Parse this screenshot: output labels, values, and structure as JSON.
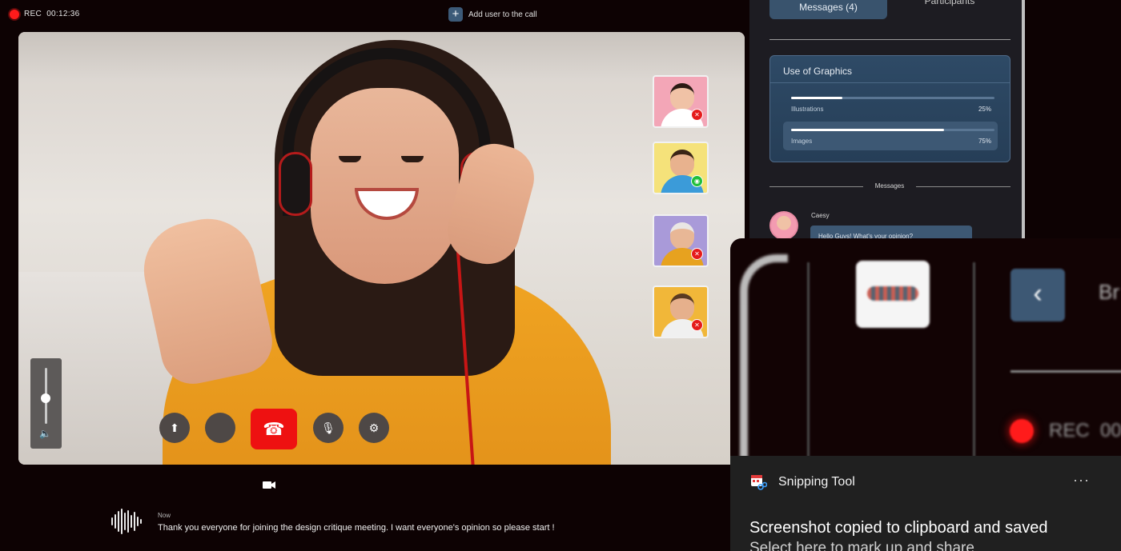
{
  "topbar": {
    "rec_label": "REC",
    "rec_time": "00:12:36",
    "add_user_label": "Add user to the call"
  },
  "call": {
    "participants_thumbs": [
      {
        "name": "participant-1",
        "muted": true
      },
      {
        "name": "participant-2",
        "muted": false
      },
      {
        "name": "participant-3",
        "muted": true
      },
      {
        "name": "participant-4",
        "muted": true
      }
    ],
    "volume_level": 0.5
  },
  "caption": {
    "time": "Now",
    "text": "Thank you everyone for joining the design critique meeting. I want everyone's opinion so please start !"
  },
  "panel": {
    "tabs": [
      {
        "label": "Messages (4)",
        "active": true
      },
      {
        "label": "Participants",
        "active": false
      }
    ],
    "card": {
      "title": "Use of Graphics",
      "rows": [
        {
          "label": "Illustrations",
          "percent_text": "25%",
          "value": 0.25
        },
        {
          "label": "Images",
          "percent_text": "75%",
          "value": 0.75
        }
      ]
    },
    "messages_divider": "Messages",
    "message": {
      "sender": "Caesy",
      "text": "Hello Guys! What's your opinion?"
    }
  },
  "preview": {
    "brand_fragment": "Br",
    "rec_label": "REC",
    "rec_time_fragment": "00"
  },
  "toast": {
    "app_name": "Snipping Tool",
    "more_label": "···",
    "title": "Screenshot copied to clipboard and saved",
    "subtitle": "Select here to mark up and share"
  },
  "colors": {
    "background": "#0d0203",
    "accent_red": "#ee1111",
    "panel_blue": "#39536d",
    "toast_bg": "#202020"
  }
}
